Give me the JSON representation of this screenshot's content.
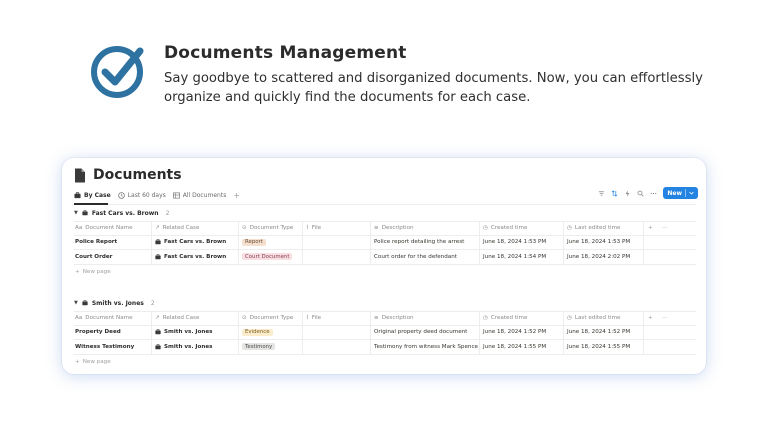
{
  "hero": {
    "title": "Documents Management",
    "text": "Say goodbye to scattered and disorganized documents. Now, you can effortlessly organize and quickly find the documents for each case.",
    "icon": "check-circle-icon",
    "accent": "#2e72a1"
  },
  "database": {
    "title": "Documents",
    "views": [
      {
        "label": "By Case",
        "icon": "briefcase-icon",
        "active": true
      },
      {
        "label": "Last 60 days",
        "icon": "clock-icon",
        "active": false
      },
      {
        "label": "All Documents",
        "icon": "table-icon",
        "active": false
      }
    ],
    "add_view": "+",
    "toolbar": {
      "new_label": "New",
      "new_color": "#2383e2"
    },
    "columns": {
      "name": "Document Name",
      "case": "Related Case",
      "type": "Document Type",
      "file": "File",
      "description": "Description",
      "created": "Created time",
      "edited": "Last edited time",
      "add": "+",
      "more": "···"
    },
    "name_prefix": "Aa",
    "new_page": "New page",
    "groups": [
      {
        "name": "Fast Cars vs. Brown",
        "count": "2",
        "rows": [
          {
            "name": "Police Report",
            "case": "Fast Cars vs. Brown",
            "type": "Report",
            "type_style": "report",
            "description": "Police report detailing the arrest",
            "created": "June 18, 2024 1:53 PM",
            "edited": "June 18, 2024 1:53 PM"
          },
          {
            "name": "Court Order",
            "case": "Fast Cars vs. Brown",
            "type": "Court Document",
            "type_style": "court",
            "description": "Court order for the defendant",
            "created": "June 18, 2024 1:54 PM",
            "edited": "June 18, 2024 2:02 PM"
          }
        ]
      },
      {
        "name": "Smith vs. Jones",
        "count": "2",
        "rows": [
          {
            "name": "Property Deed",
            "case": "Smith vs. Jones",
            "type": "Evidence",
            "type_style": "evidence",
            "description": "Original property deed document",
            "created": "June 18, 2024 1:52 PM",
            "edited": "June 18, 2024 1:52 PM"
          },
          {
            "name": "Witness Testimony",
            "case": "Smith vs. Jones",
            "type": "Testimony",
            "type_style": "testimony",
            "description": "Testimony from witness Mark Spence",
            "created": "June 18, 2024 1:55 PM",
            "edited": "June 18, 2024 1:55 PM"
          }
        ]
      }
    ]
  }
}
